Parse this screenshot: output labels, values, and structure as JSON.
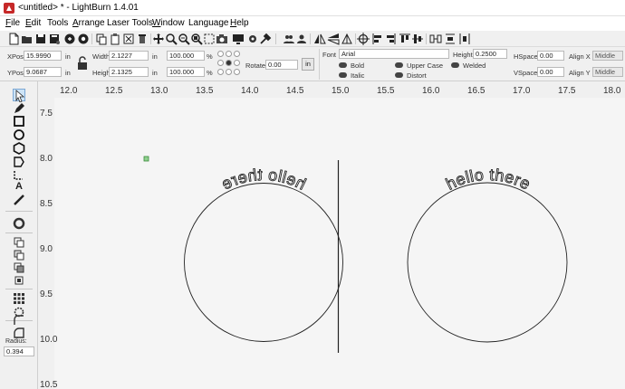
{
  "window": {
    "title": "<untitled> * - LightBurn 1.4.01"
  },
  "menu": [
    {
      "accel": "F",
      "rest": "ile"
    },
    {
      "accel": "E",
      "rest": "dit"
    },
    {
      "accel": "",
      "rest": "Tools"
    },
    {
      "accel": "A",
      "rest": "rrange"
    },
    {
      "accel": "",
      "rest": "Laser Tools"
    },
    {
      "accel": "W",
      "rest": "indow"
    },
    {
      "accel": "",
      "rest": "Language"
    },
    {
      "accel": "H",
      "rest": "elp"
    }
  ],
  "toolbar_icons": [
    "new-file",
    "open-file",
    "save-file",
    "save-as",
    "import",
    "close",
    "copy",
    "paste",
    "cut",
    "delete",
    "move",
    "zoom-in",
    "zoom-out",
    "zoom-fit",
    "select-rect",
    "camera-capture",
    "monitor",
    "settings",
    "tools",
    "users",
    "group",
    "mirror-h",
    "mirror-v",
    "align",
    "target",
    "align-left",
    "align-center",
    "align-right",
    "distribute",
    "distribute-v"
  ],
  "props": {
    "xpos_label": "XPos",
    "xpos": "15.9990",
    "xpos_unit": "in",
    "ypos_label": "YPos",
    "ypos": "9.0687",
    "ypos_unit": "in",
    "width_label": "Width",
    "width": "2.1227",
    "width_unit": "in",
    "height_label": "Height",
    "height": "2.1325",
    "height_unit": "in",
    "scale_x": "100.000",
    "scale_y": "100.000",
    "percent": "%",
    "rotate_label": "Rotate",
    "rotate": "0.00",
    "in_button": "in",
    "font_label": "Font",
    "font": "Arial",
    "text_height_label": "Height",
    "text_height": "0.2500",
    "bold": "Bold",
    "italic": "Italic",
    "upper_case": "Upper Case",
    "distort": "Distort",
    "welded": "Welded",
    "hspace_label": "HSpace",
    "hspace": "0.00",
    "vspace_label": "VSpace",
    "vspace": "0.00",
    "alignx_label": "Align X",
    "alignx": "Middle",
    "aligny_label": "Align Y",
    "aligny": "Middle"
  },
  "left_tools": {
    "radius_label": "Radius:",
    "radius": "0.394"
  },
  "ruler": {
    "x_ticks": [
      "12.0",
      "12.5",
      "13.0",
      "13.5",
      "14.0",
      "14.5",
      "15.0",
      "15.5",
      "16.0",
      "16.5",
      "17.0",
      "17.5",
      "18.0"
    ],
    "y_ticks": [
      "7.5",
      "8.0",
      "8.5",
      "9.0",
      "9.5",
      "10.0",
      "10.5"
    ]
  },
  "canvas": {
    "text_left": "hello there",
    "text_right": "hello there"
  }
}
